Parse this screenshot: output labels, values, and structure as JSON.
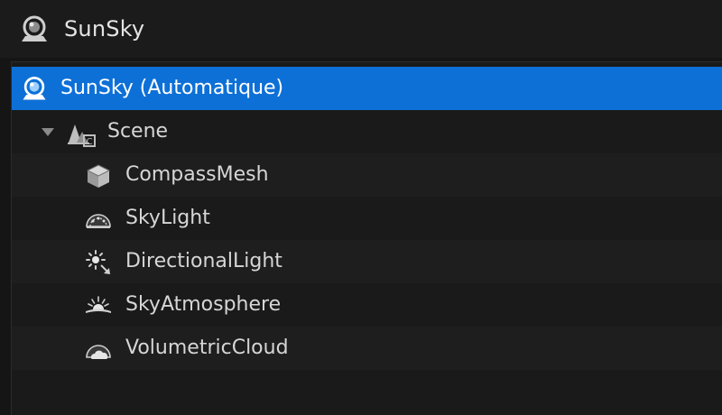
{
  "header": {
    "title": "SunSky",
    "icon": "sunsky-actor-icon"
  },
  "tree": {
    "root": {
      "label": "SunSky (Automatique)",
      "icon": "sunsky-actor-icon",
      "selected": true
    },
    "scene": {
      "label": "Scene",
      "icon": "scene-component-icon",
      "expanded": true
    },
    "children": [
      {
        "label": "CompassMesh",
        "icon": "static-mesh-icon"
      },
      {
        "label": "SkyLight",
        "icon": "sky-light-icon"
      },
      {
        "label": "DirectionalLight",
        "icon": "directional-light-icon"
      },
      {
        "label": "SkyAtmosphere",
        "icon": "sky-atmosphere-icon"
      },
      {
        "label": "VolumetricCloud",
        "icon": "volumetric-cloud-icon"
      }
    ]
  },
  "colors": {
    "selection": "#0d70d7",
    "background": "#151515"
  }
}
